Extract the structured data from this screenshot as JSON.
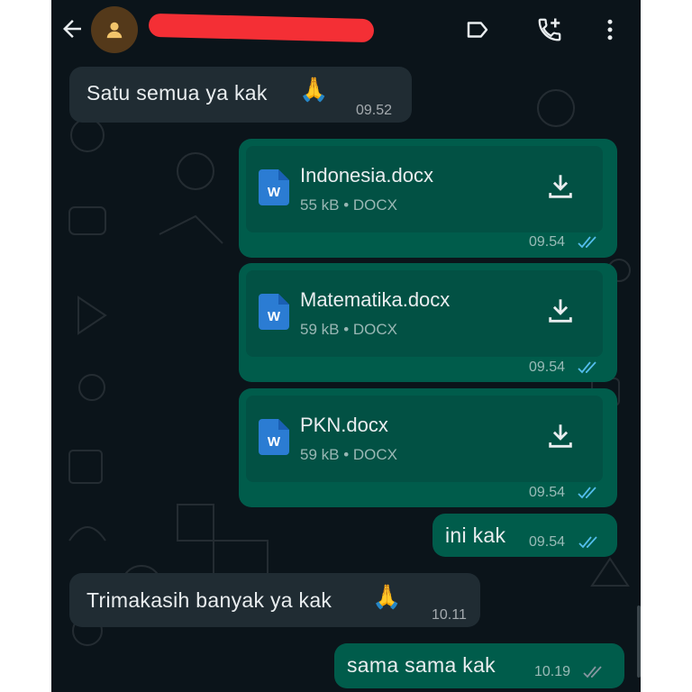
{
  "colors": {
    "chat_background": "#0b141a",
    "incoming_bubble": "#202c33",
    "outgoing_bubble": "#005c4b",
    "read_ticks": "#53bdeb",
    "redaction": "#f42f35"
  },
  "header": {
    "back_icon": "arrow-left-icon",
    "avatar_icon": "person-icon",
    "label_icon": "label-icon",
    "call_icon": "add-call-icon",
    "menu_icon": "more-vert-icon"
  },
  "messages": [
    {
      "direction": "incoming",
      "text": "Satu semua ya kak",
      "emoji": "🙏",
      "time": "09.52"
    },
    {
      "direction": "outgoing",
      "type": "document",
      "file_name": "Indonesia.docx",
      "meta": "55 kB • DOCX",
      "time": "09.54",
      "status": "read"
    },
    {
      "direction": "outgoing",
      "type": "document",
      "file_name": "Matematika.docx",
      "meta": "59 kB • DOCX",
      "time": "09.54",
      "status": "read"
    },
    {
      "direction": "outgoing",
      "type": "document",
      "file_name": "PKN.docx",
      "meta": "59 kB • DOCX",
      "time": "09.54",
      "status": "read"
    },
    {
      "direction": "outgoing",
      "text": "ini kak",
      "time": "09.54",
      "status": "read"
    },
    {
      "direction": "incoming",
      "text": "Trimakasih banyak ya kak",
      "emoji": "🙏",
      "time": "10.11"
    },
    {
      "direction": "outgoing",
      "text": "sama sama kak",
      "time": "10.19",
      "status": "delivered"
    }
  ]
}
